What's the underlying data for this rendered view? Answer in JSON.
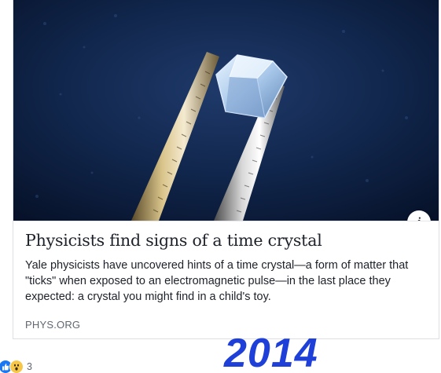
{
  "link_preview": {
    "headline": "Physicists find signs of a time crystal",
    "description": "Yale physicists have uncovered hints of a time crystal—a form of matter that \"ticks\" when exposed to an electromagnetic pulse—in the last place they expected: a crystal you might find in a child's toy.",
    "source": "PHYS.ORG",
    "info_icon_glyph": "i",
    "image_icon": "crystal-in-tweezers-photo"
  },
  "reactions": {
    "icons": [
      "like-icon",
      "wow-icon"
    ],
    "count": "3"
  },
  "overlay": {
    "year": "2014",
    "color": "#1e40d8"
  },
  "colors": {
    "text_primary": "#1d2129",
    "text_secondary": "#606770",
    "like_blue": "#1877f2",
    "wow_yellow": "#f7c74a"
  }
}
